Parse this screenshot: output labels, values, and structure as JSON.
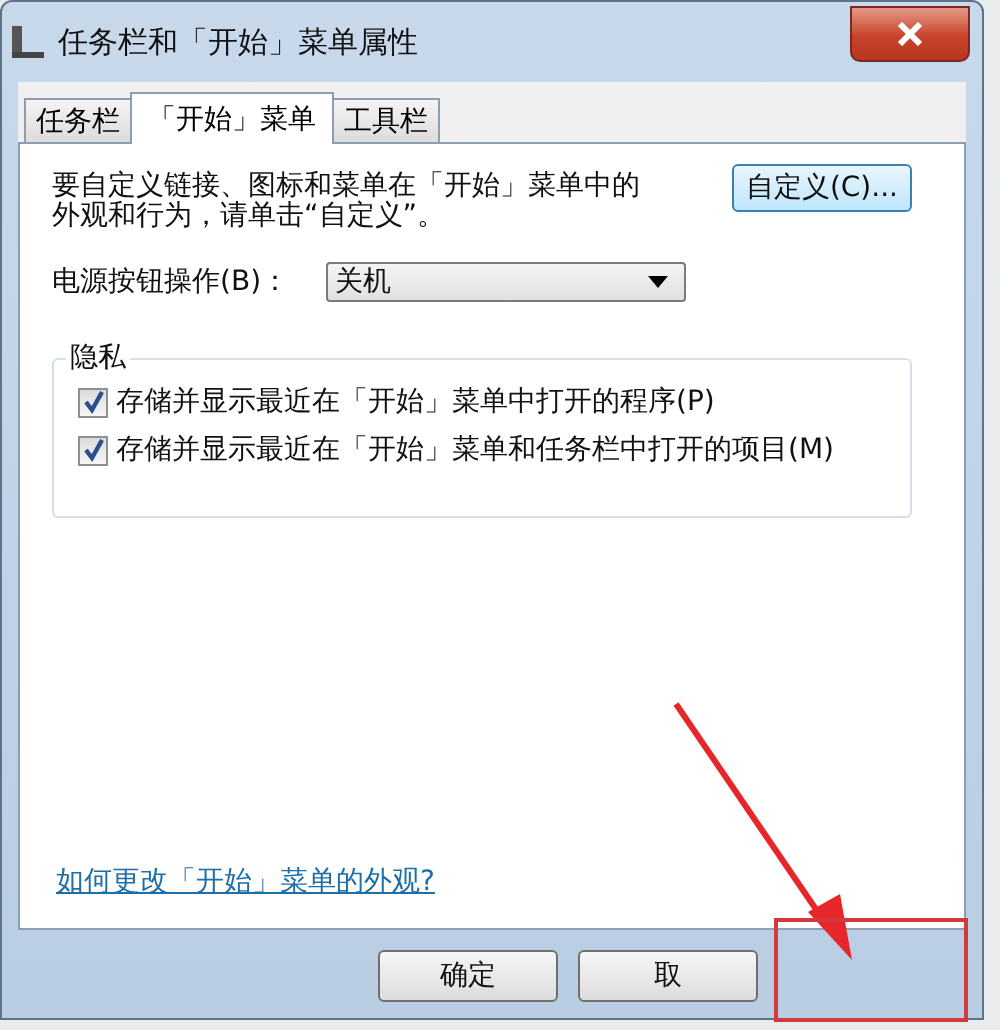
{
  "window": {
    "title": "任务栏和「开始」菜单属性"
  },
  "tabs": [
    {
      "label": "任务栏",
      "selected": false
    },
    {
      "label": "「开始」菜单",
      "selected": true
    },
    {
      "label": "工具栏",
      "selected": false
    }
  ],
  "intro": "要自定义链接、图标和菜单在「开始」菜单中的外观和行为，请单击“自定义”。",
  "customize_button": "自定义(C)...",
  "power": {
    "label": "电源按钮操作(B)：",
    "value": "关机"
  },
  "privacy": {
    "title": "隐私",
    "options": [
      {
        "label": "存储并显示最近在「开始」菜单中打开的程序(P)",
        "checked": true
      },
      {
        "label": "存储并显示最近在「开始」菜单和任务栏中打开的项目(M)",
        "checked": true
      }
    ]
  },
  "help_link": "如何更改「开始」菜单的外观?",
  "buttons": [
    "确定",
    "取"
  ]
}
